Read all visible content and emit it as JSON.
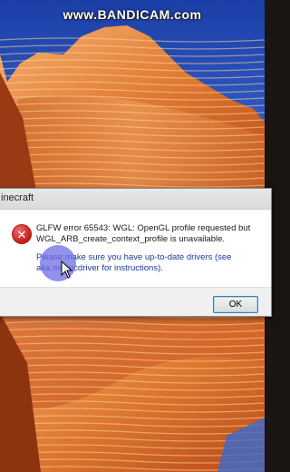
{
  "watermark": "www.BANDICAM.com",
  "dialog": {
    "title": "inecraft",
    "icon": "error-icon",
    "message_line1": "GLFW error 65543: WGL: OpenGL profile requested but WGL_ARB_create_context_profile is unavailable.",
    "message_line2": "Please make sure you have up-to-date drivers (see aka.ms/mcdriver for instructions).",
    "ok_label": "OK"
  },
  "colors": {
    "error_red": "#c91a1a",
    "cursor_highlight": "#6e6ee6",
    "ok_border": "#3c7fb1"
  }
}
